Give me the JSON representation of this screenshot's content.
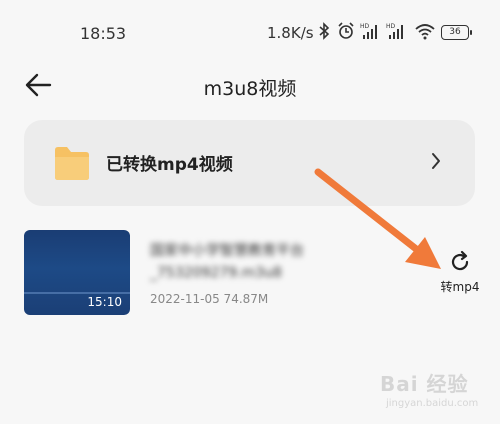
{
  "status": {
    "time": "18:53",
    "speed": "1.8K/s",
    "battery": "36",
    "icons": [
      "bluetooth-icon",
      "alarm-icon",
      "signal-hd-icon",
      "signal-hd-icon",
      "wifi-icon",
      "battery-icon"
    ]
  },
  "header": {
    "title": "m3u8视频",
    "back_icon": "back-arrow-icon"
  },
  "folder": {
    "label": "已转换mp4视频",
    "icon": "folder-icon",
    "color": "#f6c163"
  },
  "files": [
    {
      "name_line1": "国家中小学智慧教育平台",
      "name_line2": "_753209279.m3u8",
      "meta": "2022-11-05 74.87M",
      "duration": "15:10",
      "action_label": "转mp4",
      "action_icon": "refresh-icon"
    }
  ],
  "annotation": {
    "arrow_color": "#f07a3a"
  },
  "watermark": {
    "text": "Bai 经验",
    "sub": "jingyan.baidu.com"
  }
}
